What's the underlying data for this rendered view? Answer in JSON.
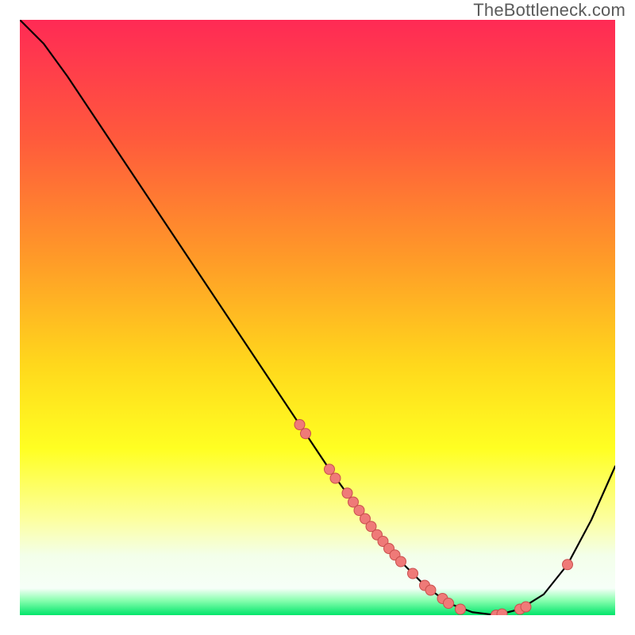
{
  "attribution": "TheBottleneck.com",
  "chart_data": {
    "type": "line",
    "title": "",
    "xlabel": "",
    "ylabel": "",
    "x_range": [
      0,
      1
    ],
    "y_range": [
      0,
      1
    ],
    "series": [
      {
        "name": "curve",
        "x": [
          0.0,
          0.04,
          0.08,
          0.12,
          0.16,
          0.2,
          0.24,
          0.28,
          0.32,
          0.36,
          0.4,
          0.44,
          0.48,
          0.52,
          0.56,
          0.6,
          0.64,
          0.68,
          0.72,
          0.76,
          0.8,
          0.84,
          0.88,
          0.92,
          0.96,
          1.0
        ],
        "y": [
          1.0,
          0.96,
          0.905,
          0.845,
          0.785,
          0.725,
          0.665,
          0.605,
          0.545,
          0.485,
          0.425,
          0.365,
          0.305,
          0.245,
          0.19,
          0.135,
          0.09,
          0.05,
          0.02,
          0.005,
          0.0,
          0.01,
          0.035,
          0.085,
          0.16,
          0.25
        ]
      }
    ],
    "scatter": {
      "name": "highlighted-points",
      "x": [
        0.47,
        0.48,
        0.52,
        0.53,
        0.55,
        0.56,
        0.57,
        0.58,
        0.59,
        0.6,
        0.61,
        0.62,
        0.63,
        0.64,
        0.66,
        0.68,
        0.69,
        0.71,
        0.72,
        0.74,
        0.8,
        0.81,
        0.84,
        0.85,
        0.92
      ],
      "y": [
        0.32,
        0.305,
        0.245,
        0.23,
        0.205,
        0.19,
        0.176,
        0.162,
        0.149,
        0.135,
        0.124,
        0.112,
        0.101,
        0.09,
        0.07,
        0.05,
        0.042,
        0.028,
        0.02,
        0.01,
        0.0,
        0.002,
        0.01,
        0.014,
        0.085
      ]
    },
    "gradient_stops": [
      {
        "offset": 0.0,
        "color": "#ff2a55"
      },
      {
        "offset": 0.2,
        "color": "#ff5a3c"
      },
      {
        "offset": 0.4,
        "color": "#ff9a28"
      },
      {
        "offset": 0.58,
        "color": "#ffd81c"
      },
      {
        "offset": 0.72,
        "color": "#ffff22"
      },
      {
        "offset": 0.84,
        "color": "#fcffa0"
      },
      {
        "offset": 0.9,
        "color": "#f3ffea"
      },
      {
        "offset": 0.955,
        "color": "#f6fff8"
      },
      {
        "offset": 0.975,
        "color": "#8affb0"
      },
      {
        "offset": 1.0,
        "color": "#00e56a"
      }
    ],
    "curve_color": "#000000",
    "point_color": "#ef7a78",
    "point_stroke": "#c94f4d"
  }
}
